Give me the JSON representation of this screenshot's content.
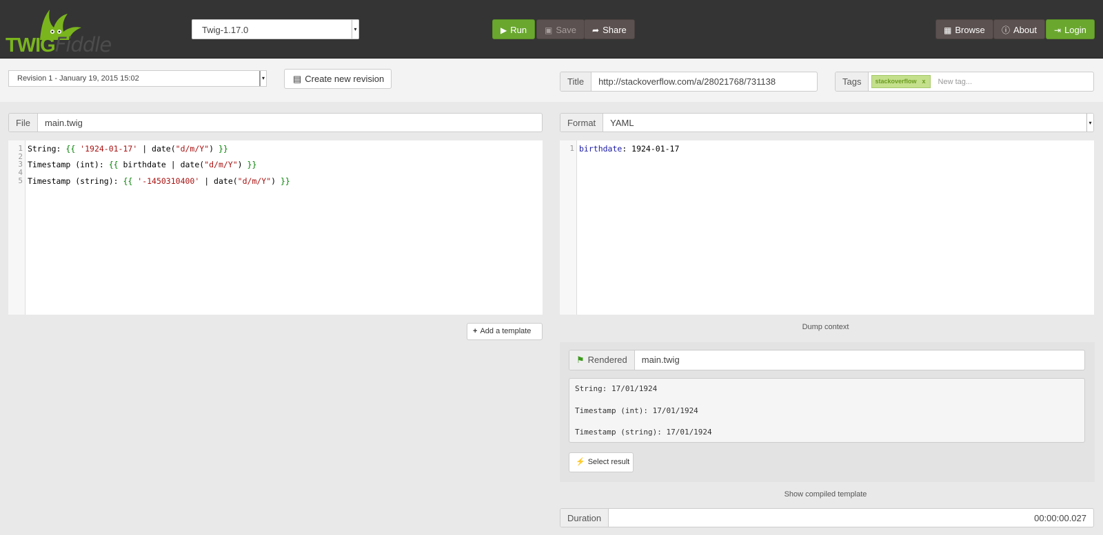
{
  "header": {
    "logo": {
      "part1": "TWIG",
      "part2": "Fiddle"
    },
    "version_select": "Twig-1.17.0",
    "run_label": "Run",
    "save_label": "Save",
    "share_label": "Share",
    "browse_label": "Browse",
    "about_label": "About",
    "login_label": "Login"
  },
  "revision": {
    "selected": "Revision 1 - January 19, 2015 15:02",
    "create_label": "Create new revision"
  },
  "meta": {
    "title_label": "Title",
    "title_value": "http://stackoverflow.com/a/28021768/731138",
    "tags_label": "Tags",
    "tags": [
      "stackoverflow"
    ],
    "tag_remove": "x",
    "new_tag_placeholder": "New tag..."
  },
  "template_editor": {
    "file_label": "File",
    "file_name": "main.twig",
    "line_numbers": [
      "1",
      "2",
      "3",
      "4",
      "5"
    ],
    "lines": [
      [
        {
          "t": "String: ",
          "c": ""
        },
        {
          "t": "{{ ",
          "c": "cm-brace"
        },
        {
          "t": "'1924-01-17'",
          "c": "cm-str"
        },
        {
          "t": " | date(",
          "c": ""
        },
        {
          "t": "\"d/m/Y\"",
          "c": "cm-str"
        },
        {
          "t": ") ",
          "c": ""
        },
        {
          "t": "}}",
          "c": "cm-brace"
        }
      ],
      [],
      [
        {
          "t": "Timestamp (int): ",
          "c": ""
        },
        {
          "t": "{{ ",
          "c": "cm-brace"
        },
        {
          "t": "birthdate | date(",
          "c": ""
        },
        {
          "t": "\"d/m/Y\"",
          "c": "cm-str"
        },
        {
          "t": ") ",
          "c": ""
        },
        {
          "t": "}}",
          "c": "cm-brace"
        }
      ],
      [],
      [
        {
          "t": "Timestamp (string): ",
          "c": ""
        },
        {
          "t": "{{ ",
          "c": "cm-brace"
        },
        {
          "t": "'-1450310400'",
          "c": "cm-str"
        },
        {
          "t": " | date(",
          "c": ""
        },
        {
          "t": "\"d/m/Y\"",
          "c": "cm-str"
        },
        {
          "t": ") ",
          "c": ""
        },
        {
          "t": "}}",
          "c": "cm-brace"
        }
      ]
    ],
    "add_template_label": "Add a template"
  },
  "context_editor": {
    "format_label": "Format",
    "format_value": "YAML",
    "line_numbers": [
      "1"
    ],
    "lines": [
      [
        {
          "t": "birthdate",
          "c": "cm-key"
        },
        {
          "t": ": 1924-01-17",
          "c": ""
        }
      ]
    ],
    "dump_context_label": "Dump context"
  },
  "result": {
    "rendered_label": "Rendered",
    "rendered_file": "main.twig",
    "output_lines": [
      "String: 17/01/1924",
      "Timestamp (int): 17/01/1924",
      "Timestamp (string): 17/01/1924"
    ],
    "select_result_label": "Select result",
    "show_compiled_label": "Show compiled template",
    "duration_label": "Duration",
    "duration_value": "00:00:00.027"
  },
  "colors": {
    "header_bg": "#343434",
    "brand_green": "#7ab51d",
    "button_green": "#6aa72f",
    "button_gray": "#5b5150"
  },
  "icons": [
    "play-icon",
    "save-icon",
    "share-icon",
    "grid-icon",
    "info-icon",
    "login-icon",
    "file-icon",
    "plus-icon",
    "flag-icon",
    "bolt-icon"
  ]
}
